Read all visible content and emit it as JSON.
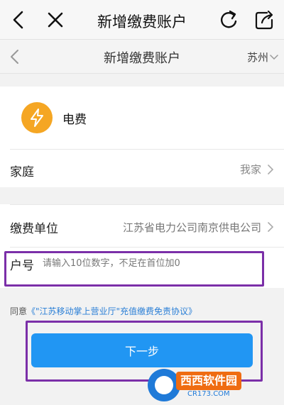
{
  "topbar": {
    "title": "新增缴费账户",
    "icons": [
      "back-icon",
      "close-icon",
      "refresh-icon",
      "share-icon"
    ]
  },
  "navbar": {
    "title": "新增缴费账户",
    "city": "苏州",
    "icons": [
      "back-icon",
      "chevron-down-icon"
    ]
  },
  "service": {
    "name": "电费",
    "icon": "lightning-icon",
    "icon_color": "#f5a623"
  },
  "fields": {
    "home": {
      "label": "家庭",
      "value": "我家"
    },
    "unit": {
      "label": "缴费单位",
      "value": "江苏省电力公司南京供电公司"
    },
    "account": {
      "label": "户号",
      "value": "",
      "placeholder": "请输入10位数字，不足在首位加0"
    }
  },
  "agreement": {
    "prefix": "同意",
    "link": "《\"江苏移动掌上营业厅\"充值缴费免责协议》"
  },
  "actions": {
    "next_label": "下一步",
    "next_color": "#2196f3"
  },
  "watermark": {
    "brand": "西西软件园",
    "url": "CR173.COM"
  },
  "colors": {
    "highlight": "#7b2fa8",
    "link": "#2a7fd6"
  }
}
